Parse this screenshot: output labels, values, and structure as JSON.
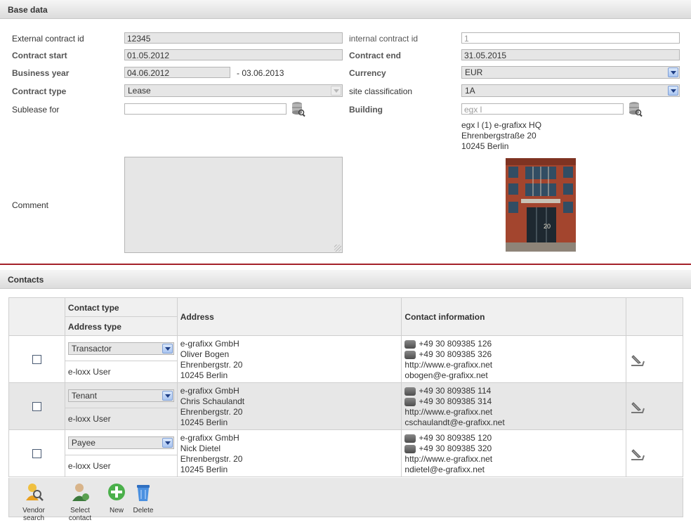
{
  "base": {
    "header": "Base data",
    "ext_id_label": "External contract id",
    "ext_id_value": "12345",
    "int_id_label": "internal contract id",
    "int_id_value": "1",
    "start_label": "Contract start",
    "start_value": "01.05.2012",
    "end_label": "Contract end",
    "end_value": "31.05.2015",
    "year_label": "Business year",
    "year_from": "04.06.2012",
    "year_to": "- 03.06.2013",
    "currency_label": "Currency",
    "currency_value": "EUR",
    "type_label": "Contract type",
    "type_value": "Lease",
    "site_label": "site classification",
    "site_value": "1A",
    "sublease_label": "Sublease for",
    "sublease_value": "",
    "building_label": "Building",
    "building_value": "egx l",
    "building_addr": [
      "egx l (1) e-grafixx HQ",
      "Ehrenbergstraße 20",
      "10245 Berlin"
    ],
    "comment_label": "Comment",
    "photo_number": "20"
  },
  "contacts": {
    "header": "Contacts",
    "col_contact_type": "Contact type",
    "col_address_type": "Address type",
    "col_address": "Address",
    "col_contact_info": "Contact information",
    "rows": [
      {
        "contact_type": "Transactor",
        "address_type": "e-loxx User",
        "address": [
          "e-grafixx GmbH",
          "Oliver Bogen",
          "Ehrenbergstr. 20",
          "10245 Berlin"
        ],
        "phone": "+49 30 809385 126",
        "fax": "+49 30 809385 326",
        "web": "http://www.e-grafixx.net",
        "email": "obogen@e-grafixx.net"
      },
      {
        "contact_type": "Tenant",
        "address_type": "e-loxx User",
        "address": [
          "e-grafixx GmbH",
          "Chris Schaulandt",
          "Ehrenbergstr. 20",
          "10245 Berlin"
        ],
        "phone": "+49 30 809385 114",
        "fax": "+49 30 809385 314",
        "web": "http://www.e-grafixx.net",
        "email": "cschaulandt@e-grafixx.net"
      },
      {
        "contact_type": "Payee",
        "address_type": "e-loxx User",
        "address": [
          "e-grafixx GmbH",
          "Nick Dietel",
          "Ehrenbergstr. 20",
          "10245 Berlin"
        ],
        "phone": "+49 30 809385 120",
        "fax": "+49 30 809385 320",
        "web": "http://www.e-grafixx.net",
        "email": "ndietel@e-grafixx.net"
      }
    ],
    "toolbar": {
      "vendor_search": "Vendor search",
      "select_contact": "Select contact",
      "new": "New",
      "delete": "Delete"
    }
  },
  "colors": {
    "section_divider": "#a4212a",
    "select_arrow": "#a9c5f1",
    "row_alt": "#e7e7e7"
  },
  "icons": [
    "database-search-icon",
    "edit-contact-icon",
    "phone-icon",
    "fax-icon",
    "vendor-search-icon",
    "select-contact-icon",
    "add-icon",
    "trash-icon"
  ]
}
